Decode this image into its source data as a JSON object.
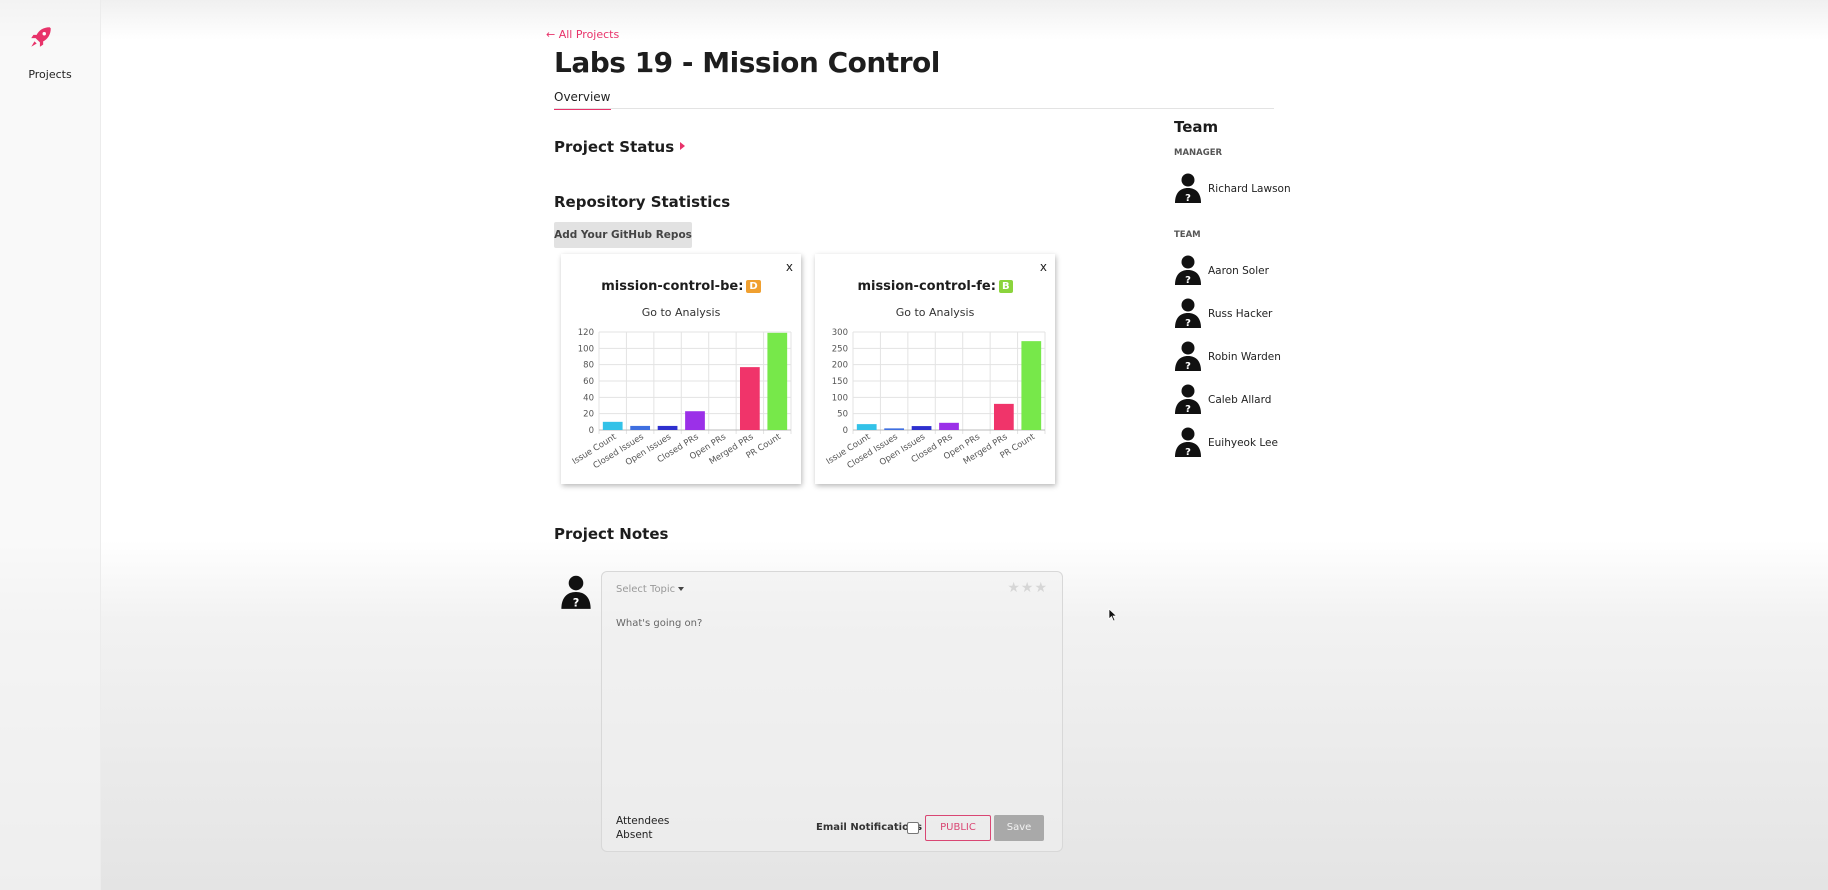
{
  "sidebar": {
    "projects_label": "Projects"
  },
  "header": {
    "back_link": "← All Projects",
    "title": "Labs 19 - Mission Control",
    "tab_overview": "Overview"
  },
  "project_status": {
    "title": "Project Status"
  },
  "repo_stats": {
    "title": "Repository Statistics",
    "add_button": "Add Your GitHub Repos",
    "close_label": "x",
    "go_analysis": "Go to Analysis",
    "repos": [
      {
        "name": "mission-control-be:",
        "grade": "D",
        "grade_color": "#f0a030"
      },
      {
        "name": "mission-control-fe:",
        "grade": "B",
        "grade_color": "#8bd43c"
      }
    ]
  },
  "chart_data": [
    {
      "type": "bar",
      "categories": [
        "Issue Count",
        "Closed Issues",
        "Open Issues",
        "Closed PRs",
        "Open PRs",
        "Merged PRs",
        "PR Count"
      ],
      "values": [
        10,
        5,
        5,
        23,
        0,
        77,
        119
      ],
      "colors": [
        "#33c2e8",
        "#3f6fe0",
        "#2e30cf",
        "#9b30e8",
        "#cccccc",
        "#f0346a",
        "#77e84a"
      ],
      "ylim": [
        0,
        120
      ],
      "yticks": [
        0,
        20,
        40,
        60,
        80,
        100,
        120
      ],
      "grid": true
    },
    {
      "type": "bar",
      "categories": [
        "Issue Count",
        "Closed Issues",
        "Open Issues",
        "Closed PRs",
        "Open PRs",
        "Merged PRs",
        "PR Count"
      ],
      "values": [
        18,
        5,
        12,
        22,
        0,
        80,
        272
      ],
      "colors": [
        "#33c2e8",
        "#3f6fe0",
        "#2e30cf",
        "#9b30e8",
        "#cccccc",
        "#f0346a",
        "#77e84a"
      ],
      "ylim": [
        0,
        300
      ],
      "yticks": [
        0,
        50,
        100,
        150,
        200,
        250,
        300
      ],
      "grid": true
    }
  ],
  "team": {
    "title": "Team",
    "manager_label": "MANAGER",
    "manager": "Richard Lawson",
    "team_label": "TEAM",
    "members": [
      "Aaron Soler",
      "Russ Hacker",
      "Robin Warden",
      "Caleb Allard",
      "Euihyeok Lee"
    ]
  },
  "notes": {
    "title": "Project Notes",
    "topic_placeholder": "Select Topic",
    "input_placeholder": "What's going on?",
    "attendees_label": "Attendees",
    "absent_label": "Absent",
    "email_label": "Email Notifications",
    "public_button": "PUBLIC",
    "save_button": "Save",
    "stars": "★★★"
  },
  "colors": {
    "accent": "#e8336a"
  }
}
